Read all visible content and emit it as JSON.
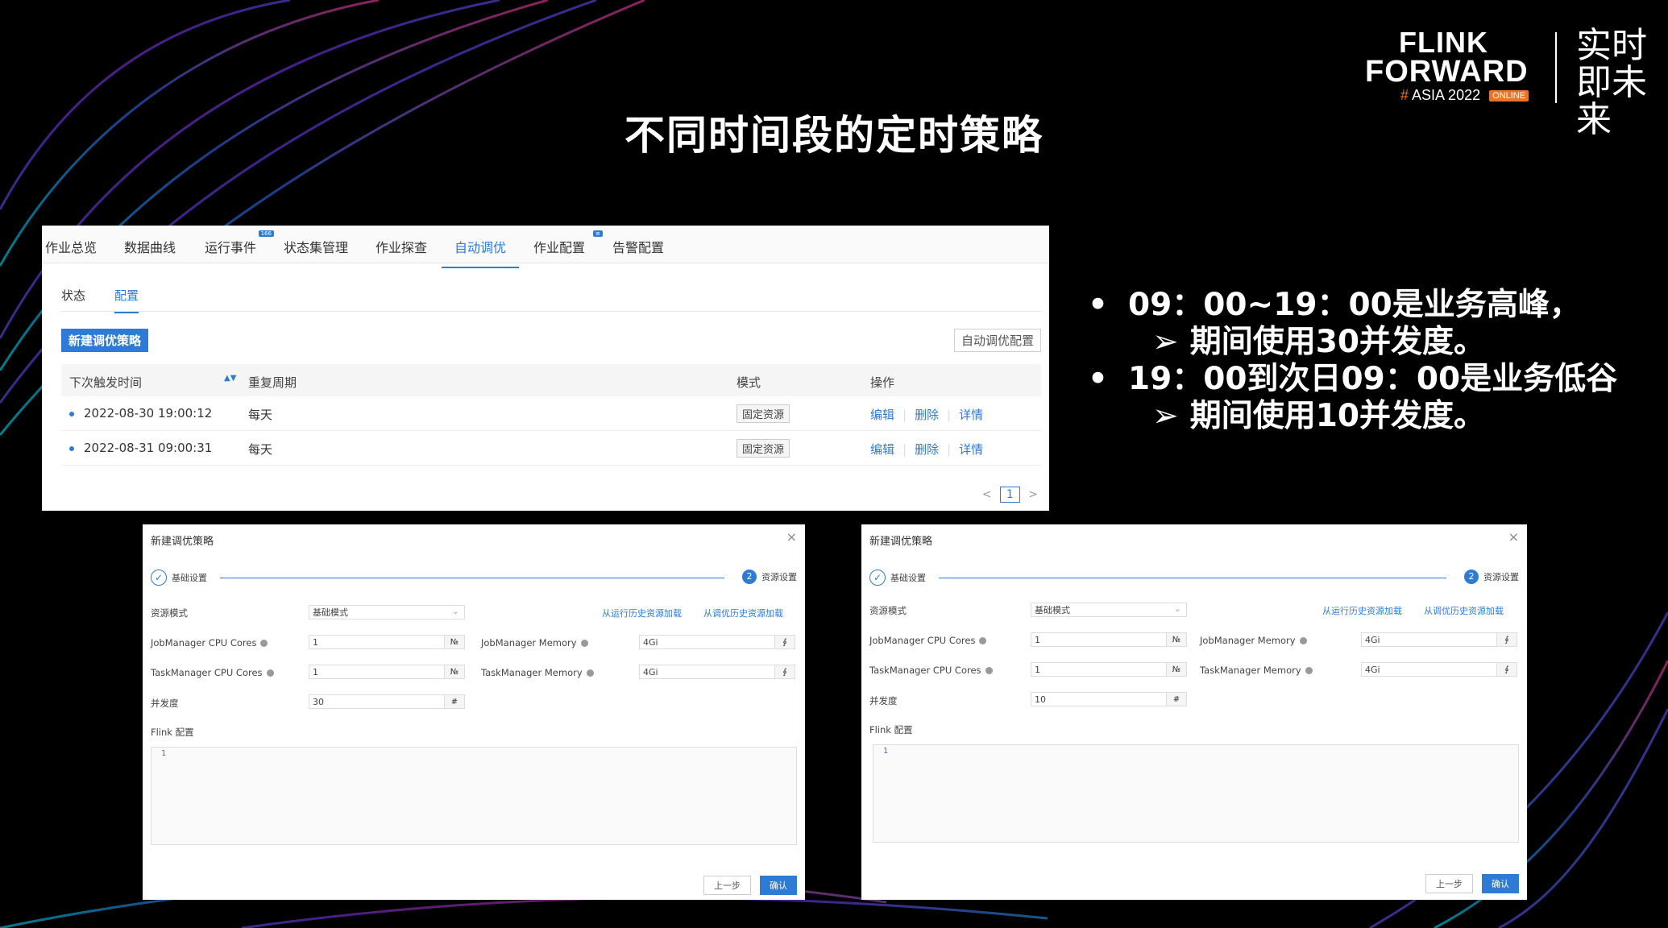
{
  "slide": {
    "title": "不同时间段的定时策略",
    "bullets": [
      {
        "text": "09：00~19：00是业务高峰，",
        "sub": "期间使用30并发度。"
      },
      {
        "text": "19：00到次日09：00是业务低谷",
        "sub": "期间使用10并发度。"
      }
    ],
    "arrow": "➢"
  },
  "logo": {
    "line1": "FLINK",
    "line2": "FORWARD",
    "hash": "#",
    "line3": "ASIA 2022",
    "online": "ONLINE",
    "slogan": "实时即未来"
  },
  "top_panel": {
    "tabs": [
      {
        "label": "作业总览",
        "badge": ""
      },
      {
        "label": "数据曲线",
        "badge": ""
      },
      {
        "label": "运行事件",
        "badge": "166"
      },
      {
        "label": "状态集管理",
        "badge": ""
      },
      {
        "label": "作业探查",
        "badge": ""
      },
      {
        "label": "自动调优",
        "badge": ""
      },
      {
        "label": "作业配置",
        "badge": "≡"
      },
      {
        "label": "告警配置",
        "badge": ""
      }
    ],
    "subtabs": [
      "状态",
      "配置"
    ],
    "new_button": "新建调优策略",
    "auto_button": "自动调优配置",
    "columns": [
      "下次触发时间",
      "重复周期",
      "模式",
      "操作"
    ],
    "sort_icon": "▲▼",
    "rows": [
      {
        "time": "2022-08-30 19:00:12",
        "period": "每天",
        "mode": "固定资源",
        "actions": [
          "编辑",
          "删除",
          "详情"
        ]
      },
      {
        "time": "2022-08-31 09:00:31",
        "period": "每天",
        "mode": "固定资源",
        "actions": [
          "编辑",
          "删除",
          "详情"
        ]
      }
    ],
    "pager": {
      "prev": "<",
      "page": "1",
      "next": ">"
    }
  },
  "dialogs": [
    {
      "title": "新建调优策略",
      "close": "×",
      "step1": "基础设置",
      "step2_num": "2",
      "step2": "资源设置",
      "resource_mode_label": "资源模式",
      "resource_mode_value": "基础模式",
      "link1": "从运行历史资源加载",
      "link2": "从调优历史资源加载",
      "jm_cpu_label": "JobManager CPU Cores",
      "jm_cpu_value": "1",
      "jm_mem_label": "JobManager Memory",
      "jm_mem_value": "4Gi",
      "tm_cpu_label": "TaskManager CPU Cores",
      "tm_cpu_value": "1",
      "tm_mem_label": "TaskManager Memory",
      "tm_mem_value": "4Gi",
      "parallelism_label": "并发度",
      "parallelism_value": "30",
      "flink_conf_label": "Flink 配置",
      "editor_line": "1",
      "prev_button": "上一步",
      "ok_button": "确认"
    },
    {
      "title": "新建调优策略",
      "close": "×",
      "step1": "基础设置",
      "step2_num": "2",
      "step2": "资源设置",
      "resource_mode_label": "资源模式",
      "resource_mode_value": "基础模式",
      "link1": "从运行历史资源加载",
      "link2": "从调优历史资源加载",
      "jm_cpu_label": "JobManager CPU Cores",
      "jm_cpu_value": "1",
      "jm_mem_label": "JobManager Memory",
      "jm_mem_value": "4Gi",
      "tm_cpu_label": "TaskManager CPU Cores",
      "tm_cpu_value": "1",
      "tm_mem_label": "TaskManager Memory",
      "tm_mem_value": "4Gi",
      "parallelism_label": "并发度",
      "parallelism_value": "10",
      "flink_conf_label": "Flink 配置",
      "editor_line": "1",
      "prev_button": "上一步",
      "ok_button": "确认"
    }
  ],
  "suffix_icons": {
    "cores": "№",
    "memory": "∮",
    "parallel": "#"
  }
}
